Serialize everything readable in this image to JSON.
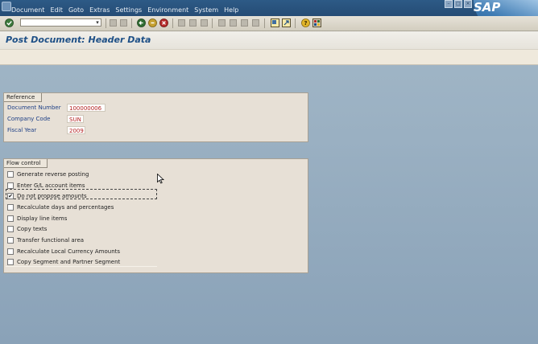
{
  "menu": [
    "Document",
    "Edit",
    "Goto",
    "Extras",
    "Settings",
    "Environment",
    "System",
    "Help"
  ],
  "brand": "SAP",
  "toolbar": {
    "command_value": "",
    "icons": [
      "enter-icon",
      "back-icon",
      "exit-icon",
      "cancel-icon",
      "print-icon",
      "find-icon",
      "first-page-icon",
      "previous-page-icon",
      "next-page-icon",
      "last-page-icon",
      "create-session-icon",
      "shortcut-icon",
      "help-icon",
      "layout-icon"
    ]
  },
  "title": "Post Document: Header Data",
  "reference": {
    "tab": "Reference",
    "fields": [
      {
        "label": "Document Number",
        "value": "100000006"
      },
      {
        "label": "Company Code",
        "value": "SUN"
      },
      {
        "label": "Fiscal Year",
        "value": "2009"
      }
    ]
  },
  "flow_control": {
    "tab": "Flow control",
    "options": [
      {
        "label": "Generate reverse posting",
        "checked": false
      },
      {
        "label": "Enter G/L account items",
        "checked": false
      },
      {
        "label": "Do not propose amounts",
        "checked": true
      },
      {
        "label": "Recalculate days and percentages",
        "checked": false
      },
      {
        "label": "Display line items",
        "checked": false
      },
      {
        "label": "Copy texts",
        "checked": false
      },
      {
        "label": "Transfer functional area",
        "checked": false
      },
      {
        "label": "Recalculate Local Currency Amounts",
        "checked": false
      },
      {
        "label": "Copy Segment and Partner Segment",
        "checked": false
      }
    ]
  },
  "colors": {
    "menubar": "#2d5a86",
    "title_text": "#1d4f86",
    "label_text": "#1d3f86",
    "value_text": "#b11c1c",
    "background": "#9ab0c2"
  }
}
